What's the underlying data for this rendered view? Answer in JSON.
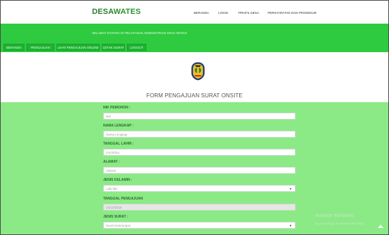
{
  "header": {
    "brand_part1": "DESA",
    "brand_part2": "WATES",
    "nav": [
      "BERANDA",
      "LOGIN",
      "PROFIL DESA",
      "PERSYARATAN DAN PROSEDUR"
    ]
  },
  "banner": {
    "service_text": "SELAMAT DATANG DI PELAYANAN ADMINISTRASI DESA WATES"
  },
  "menu": {
    "items": [
      "BERANDA",
      "PENGAJUAN SURAT",
      "LIHAT PENGAJUAN ONLINE",
      "CETAK SURAT",
      "LOGOUT"
    ]
  },
  "form": {
    "title": "FORM PENGAJUAN SURAT ONSITE",
    "fields": [
      {
        "label": "NIK PEMOHON :",
        "value": "NIK",
        "type": "text"
      },
      {
        "label": "NAMA LENGKAP :",
        "value": "Nama Lengkap",
        "type": "text"
      },
      {
        "label": "TANGGAL LAHIR :",
        "value": "mm/dd/yy",
        "type": "text"
      },
      {
        "label": "ALAMAT :",
        "value": "Alamat",
        "type": "text"
      },
      {
        "label": "JENIS KELAMIN :",
        "value": "Laki-laki",
        "type": "select"
      },
      {
        "label": "TANGGAL PENGAJUAN",
        "value": "14/12/2018",
        "type": "disabled"
      },
      {
        "label": "JENIS SURAT :",
        "value": "Surat Keterangan",
        "type": "select"
      }
    ]
  },
  "os_watermark": {
    "line1": "Activate Windows",
    "line2": "Go to Settings to activate Windows."
  },
  "colors": {
    "primary_green": "#2eca3f",
    "form_bg": "#8bea86",
    "label_green": "#2c6a2c"
  },
  "icons": {
    "logo": "emblem-icon",
    "select_arrow": "dropdown-arrow-icon",
    "back_to_top": "chevron-up-icon"
  }
}
